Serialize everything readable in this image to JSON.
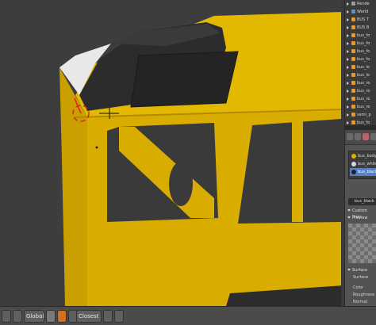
{
  "outliner": {
    "items": [
      {
        "label": "Rende",
        "icon": "camera-icon"
      },
      {
        "label": "World",
        "icon": "world-icon"
      },
      {
        "label": "BUS T",
        "icon": "object-icon"
      },
      {
        "label": "BUS B",
        "icon": "object-icon"
      },
      {
        "label": "bus_fo",
        "icon": "object-icon"
      },
      {
        "label": "bus_fo",
        "icon": "object-icon"
      },
      {
        "label": "bus_fo",
        "icon": "object-icon"
      },
      {
        "label": "bus_fo",
        "icon": "object-icon"
      },
      {
        "label": "bus_lo",
        "icon": "object-icon"
      },
      {
        "label": "bus_lo",
        "icon": "object-icon"
      },
      {
        "label": "bus_ro",
        "icon": "object-icon"
      },
      {
        "label": "bus_ro",
        "icon": "object-icon"
      },
      {
        "label": "bus_ro",
        "icon": "object-icon"
      },
      {
        "label": "bus_ro",
        "icon": "object-icon"
      },
      {
        "label": "semi_p",
        "icon": "object-icon"
      },
      {
        "label": "bus_fo",
        "icon": "object-icon"
      }
    ]
  },
  "materials": {
    "slots": [
      {
        "label": "bus_body",
        "color": "#e0b000",
        "selected": false
      },
      {
        "label": "bus_white",
        "color": "#d8d8d8",
        "selected": false
      },
      {
        "label": "bus_black",
        "color": "#202020",
        "selected": true
      }
    ],
    "field_value": "bus_black",
    "custom_props_label": "Custom Prop",
    "preview_label": "Preview",
    "surface_label": "Surface",
    "surface_value": "Surface",
    "color_label": "Color",
    "roughness_label": "Roughness",
    "normal_label": "Normal"
  },
  "statusbar": {
    "orientation_value": "Global",
    "snap_value": "Closest"
  },
  "colors": {
    "bus_yellow": "#e3b800",
    "bus_black": "#2e2e2e",
    "viewport_bg": "#3d3d3d",
    "selection_blue": "#5680c2"
  }
}
